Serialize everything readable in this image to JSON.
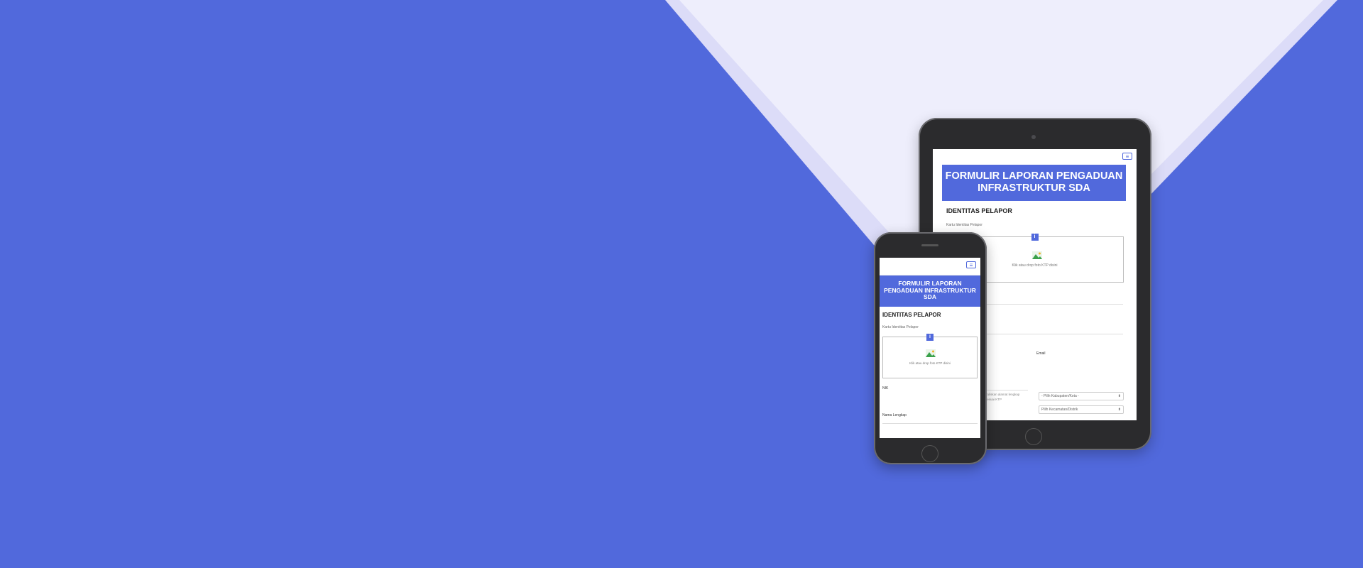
{
  "form": {
    "title": "FORMULIR LAPORAN PENGADUAN INFRASTRUKTUR SDA",
    "section_identitas": "IDENTITAS PELAPOR",
    "ktp_label": "Kartu Identitas Pelapor",
    "upload_text": "Klik atau drop foto KTP disini",
    "info_badge": "i",
    "nik_label": "NIK",
    "nama_label": "Nama Lengkap",
    "email_label": "Email",
    "address_help": "Tuliskan alamat lengkap sesuai KTP",
    "select_kabupaten": "- Pilih Kabupaten/Kota -",
    "select_kecamatan": "Pilih Kecamatan/Distrik"
  },
  "icons": {
    "menu": "hamburger-icon",
    "image": "image-placeholder-icon",
    "caret": "select-caret-icon"
  },
  "colors": {
    "background": "#5169dc",
    "accent": "#5169dc",
    "light_panel": "#eeeefc",
    "light_edge": "#dcdcf8",
    "device": "#2b2b2d"
  }
}
